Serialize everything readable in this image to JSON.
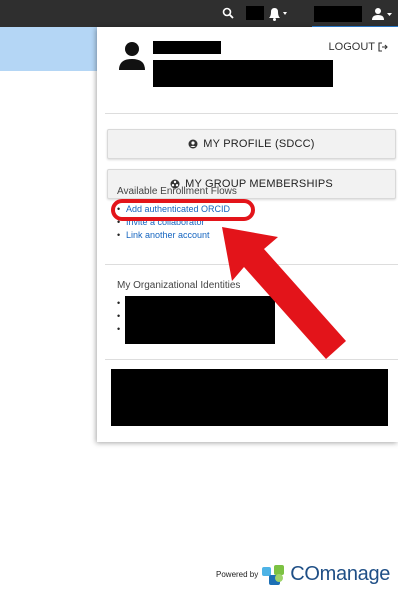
{
  "header": {
    "search_icon": "search-icon",
    "bell_icon": "bell-with-dropdown-icon",
    "user_icon": "user-with-dropdown-icon"
  },
  "menu": {
    "logout_label": "LOGOUT",
    "logout_icon": "sign-out-icon",
    "profile_button": "MY PROFILE (SDCC)",
    "groups_button": "MY GROUP MEMBERSHIPS"
  },
  "enrollment": {
    "title": "Available Enrollment Flows",
    "items": [
      "Add authenticated ORCID",
      "Invite a collaborator",
      "Link another account"
    ]
  },
  "identities": {
    "title": "My Organizational Identities"
  },
  "annotation": {
    "highlight_color": "#e3141a"
  },
  "footer": {
    "powered_by": "Powered by",
    "brand": "COmanage"
  }
}
